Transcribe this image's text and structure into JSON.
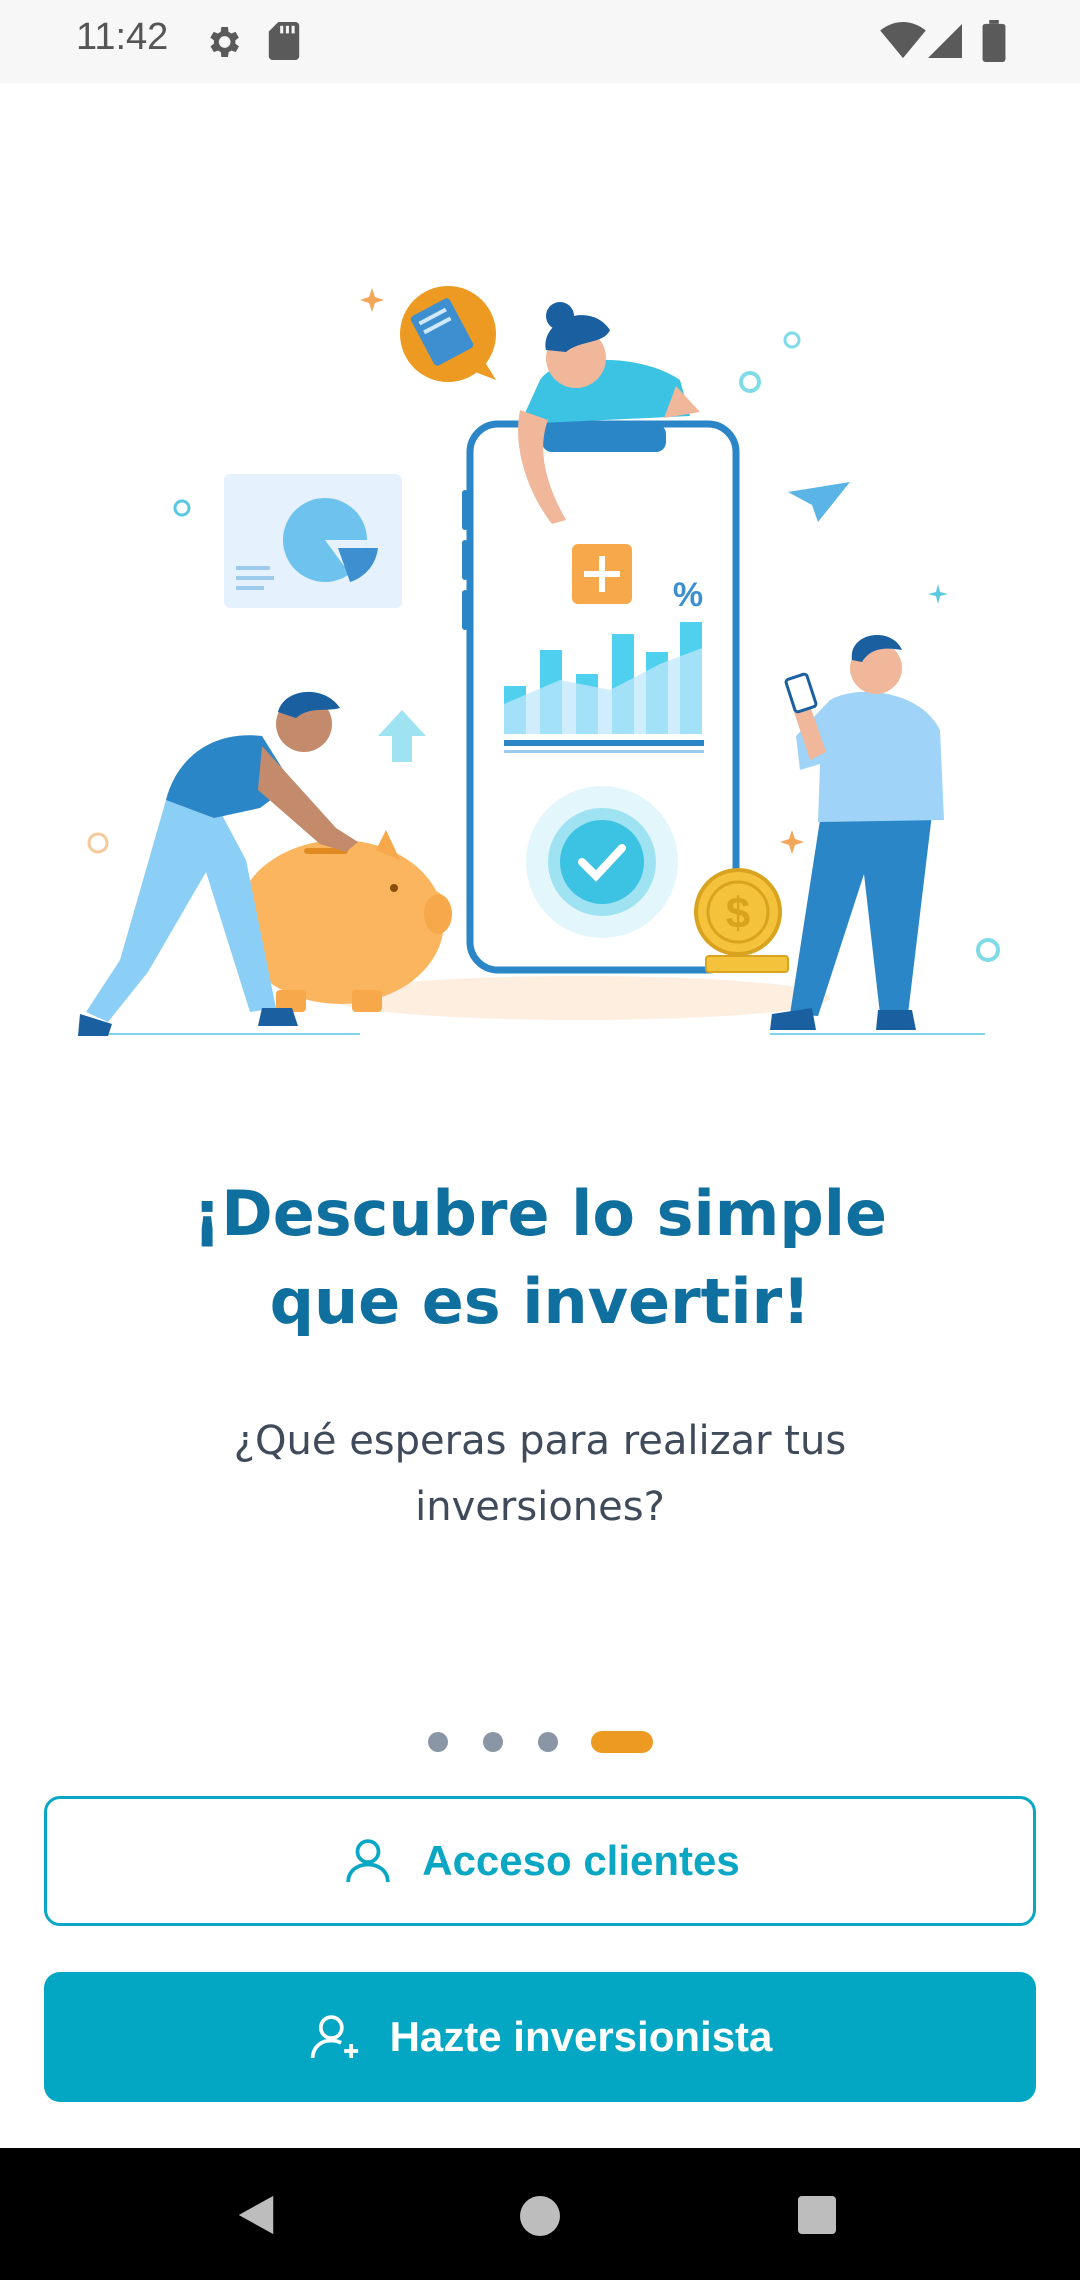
{
  "status_bar": {
    "time": "11:42",
    "icons": [
      "gear-icon",
      "sd-card-icon",
      "wifi-icon",
      "cell-signal-icon",
      "battery-icon"
    ]
  },
  "onboarding": {
    "title_line1": "¡Descubre lo simple",
    "title_line2": "que es invertir!",
    "subtitle_line1": "¿Qué esperas para realizar tus",
    "subtitle_line2": "inversiones?",
    "illustration": {
      "percent_symbol": "%",
      "dollar_symbol": "$"
    },
    "page_indicator": {
      "total": 4,
      "active_index": 3
    }
  },
  "actions": {
    "login_label": "Acceso clientes",
    "signup_label": "Hazte inversionista"
  },
  "colors": {
    "title": "#0f6f9e",
    "accent": "#04a7c3",
    "indicator_active": "#ec9a22",
    "indicator_inactive": "#8a96a6"
  },
  "nav_bar": {
    "icons": [
      "back-icon",
      "home-icon",
      "recents-icon"
    ]
  }
}
